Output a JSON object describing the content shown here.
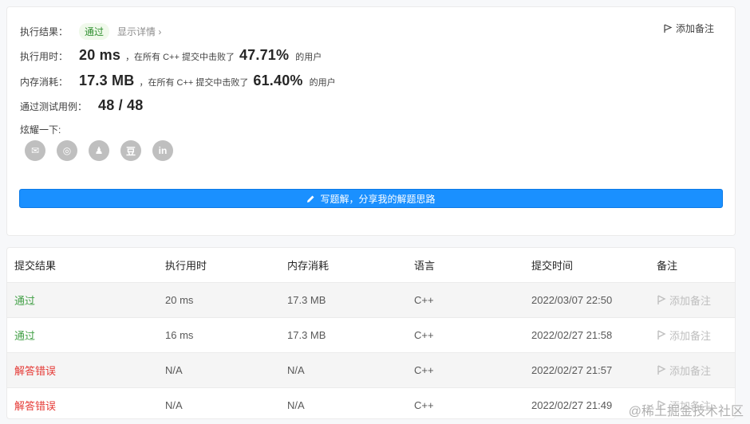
{
  "result": {
    "label_exec_result": "执行结果：",
    "status": "通过",
    "show_detail": "显示详情 ›",
    "add_note": "添加备注",
    "runtime_label": "执行用时：",
    "runtime_value": "20 ms",
    "runtime_mid": "，在所有 C++ 提交中击败了",
    "runtime_pct": "47.71%",
    "runtime_tail": "的用户",
    "memory_label": "内存消耗：",
    "memory_value": "17.3 MB",
    "memory_mid": "，在所有 C++ 提交中击败了",
    "memory_pct": "61.40%",
    "memory_tail": "的用户",
    "testcase_label": "通过测试用例：",
    "testcase_value": "48 / 48",
    "share_label": "炫耀一下:",
    "share_icons": [
      "wechat-icon",
      "weibo-icon",
      "qq-icon",
      "douban-icon",
      "linkedin-icon"
    ],
    "share_glyphs": [
      "✉",
      "◎",
      "♟",
      "豆",
      "in"
    ],
    "write_solution": "写题解，分享我的解题思路"
  },
  "table": {
    "headers": [
      "提交结果",
      "执行用时",
      "内存消耗",
      "语言",
      "提交时间",
      "备注"
    ],
    "rows": [
      {
        "status": "通过",
        "status_type": "pass",
        "runtime": "20 ms",
        "memory": "17.3 MB",
        "lang": "C++",
        "time": "2022/03/07 22:50",
        "note": "添加备注"
      },
      {
        "status": "通过",
        "status_type": "pass",
        "runtime": "16 ms",
        "memory": "17.3 MB",
        "lang": "C++",
        "time": "2022/02/27 21:58",
        "note": "添加备注"
      },
      {
        "status": "解答错误",
        "status_type": "fail",
        "runtime": "N/A",
        "memory": "N/A",
        "lang": "C++",
        "time": "2022/02/27 21:57",
        "note": "添加备注"
      },
      {
        "status": "解答错误",
        "status_type": "fail",
        "runtime": "N/A",
        "memory": "N/A",
        "lang": "C++",
        "time": "2022/02/27 21:49",
        "note": "添加备注"
      }
    ]
  },
  "watermark": "@稀土掘金技术社区",
  "colors": {
    "accent": "#1a90ff",
    "pass": "#43a047",
    "fail": "#e53935"
  }
}
